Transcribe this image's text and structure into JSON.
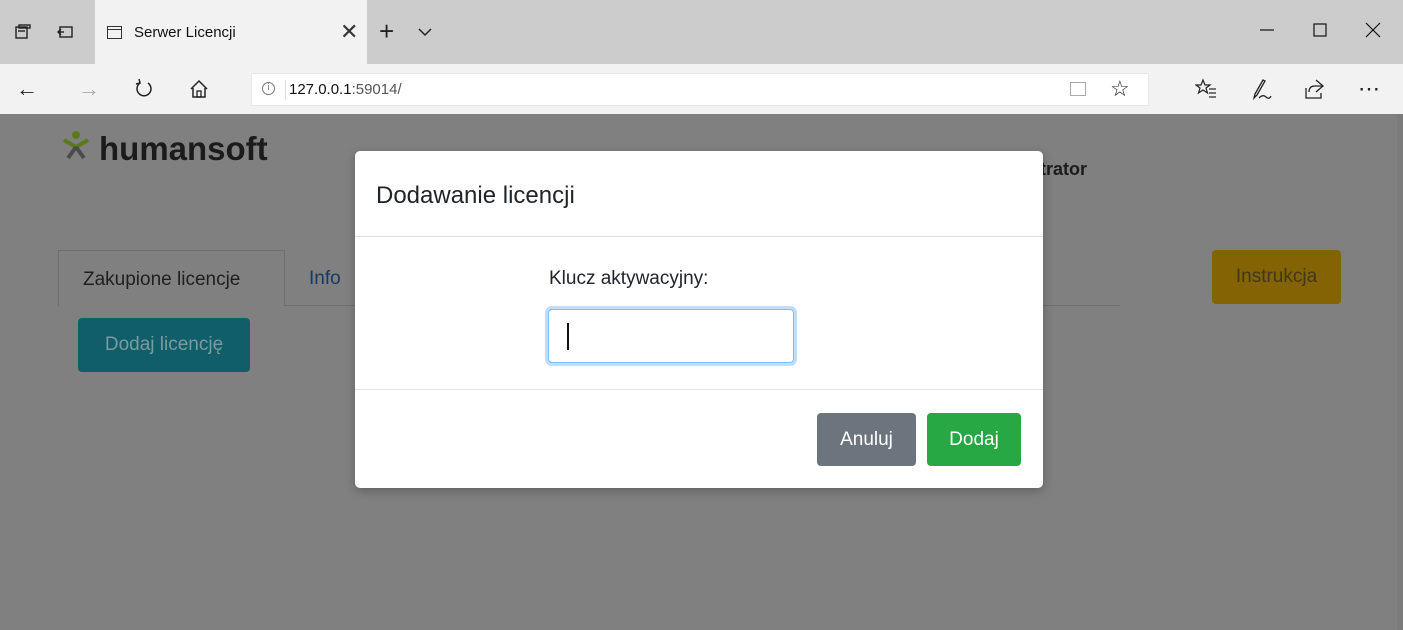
{
  "browser": {
    "tab_title": "Serwer Licencji",
    "url_host": "127.0.0.1",
    "url_rest": ":59014/",
    "info_glyph": "i",
    "icons": [
      "set-aside-tabs-icon",
      "tab-preview-icon",
      "page-icon",
      "close-icon",
      "plus-icon",
      "chevron-down-icon",
      "minimize-icon",
      "maximize-icon",
      "close-icon",
      "back-icon",
      "forward-icon",
      "refresh-icon",
      "home-icon",
      "info-icon",
      "reading-view-icon",
      "star-icon",
      "favorites-icon",
      "pen-icon",
      "share-icon",
      "more-icon"
    ]
  },
  "page": {
    "logo_text": "humansoft",
    "user_label": "strator",
    "tabs": [
      {
        "label": "Zakupione licencje"
      },
      {
        "label": "Info"
      }
    ],
    "add_license_button": "Dodaj licencję",
    "instructions_button": "Instrukcja",
    "colors": {
      "overlay": "#808080",
      "heading_green": "#1e5e22",
      "add_btn": "#105e69",
      "instr_btn": "#836304"
    }
  },
  "modal": {
    "title": "Dodawanie licencji",
    "field_label": "Klucz aktywacyjny:",
    "field_value": "",
    "cancel_label": "Anuluj",
    "confirm_label": "Dodaj",
    "colors": {
      "cancel": "#6c757d",
      "confirm": "#28a745",
      "focus": "#80bdff"
    }
  }
}
